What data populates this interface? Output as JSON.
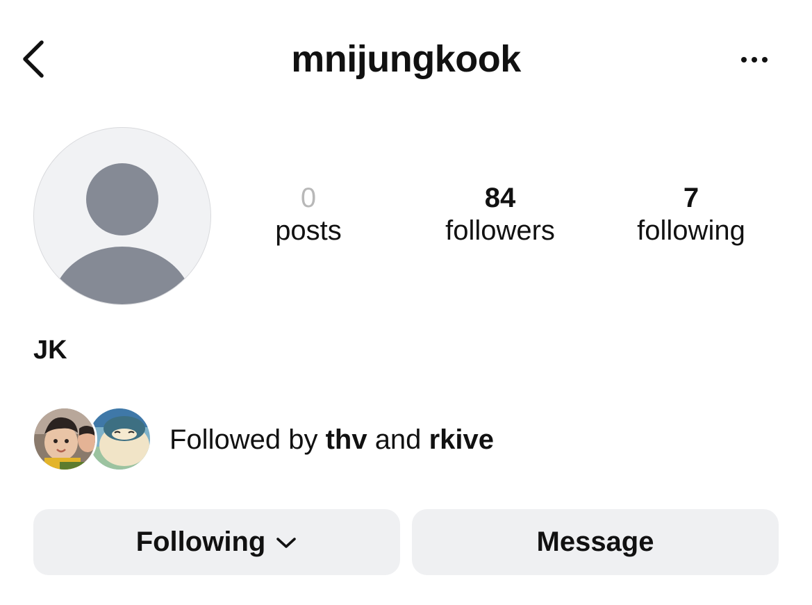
{
  "header": {
    "back_icon": "chevron-left-icon",
    "username": "mnijungkook",
    "more_icon": "more-horizontal-icon"
  },
  "profile": {
    "avatar_icon": "default-avatar-icon",
    "display_name": "JK"
  },
  "stats": [
    {
      "value": "0",
      "label": "posts"
    },
    {
      "value": "84",
      "label": "followers"
    },
    {
      "value": "7",
      "label": "following"
    }
  ],
  "mutuals": {
    "prefix": "Followed by",
    "first": "thv",
    "joiner": "and",
    "second": "rkive"
  },
  "actions": {
    "following_label": "Following",
    "following_icon": "chevron-down-icon",
    "message_label": "Message"
  },
  "colors": {
    "button_bg": "#eff0f2",
    "avatar_fill": "#858a95",
    "avatar_bg": "#f1f2f4",
    "muted_count": "#b8b8b8"
  }
}
